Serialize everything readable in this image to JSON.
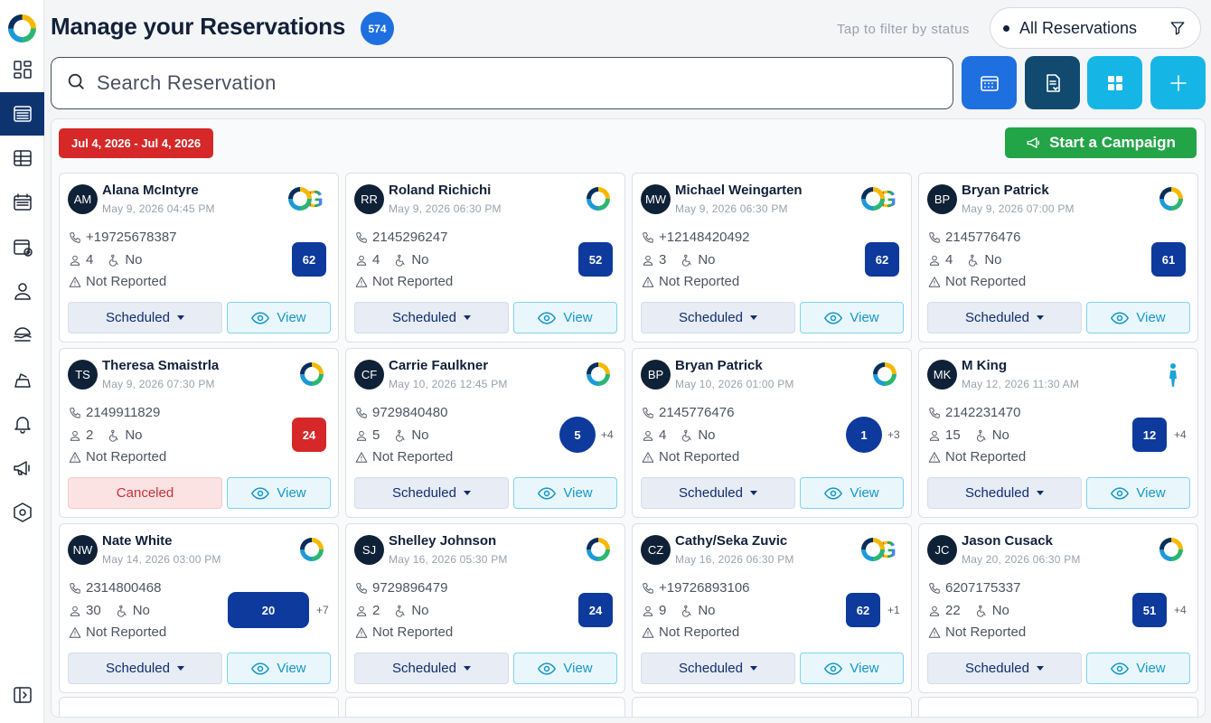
{
  "header": {
    "title": "Manage your Reservations",
    "count": "574",
    "filter_hint": "Tap to filter by status",
    "status_filter": "All Reservations"
  },
  "search": {
    "placeholder": "Search Reservation"
  },
  "date_range": "Jul 4, 2026 - Jul 4, 2026",
  "campaign_label": "Start a Campaign",
  "colors": {
    "primary": "#0e3470",
    "accent_blue": "#1e6fe0",
    "cyan": "#15b6e6",
    "red": "#d62828",
    "green": "#22a447"
  },
  "sidebar": {
    "items": [
      {
        "icon": "dashboard-icon"
      },
      {
        "icon": "reservations-list-icon",
        "active": true
      },
      {
        "icon": "table-grid-icon"
      },
      {
        "icon": "calendar-icon"
      },
      {
        "icon": "add-event-icon"
      },
      {
        "icon": "user-icon"
      },
      {
        "icon": "food-menu-icon"
      },
      {
        "icon": "service-bell-icon"
      },
      {
        "icon": "notification-bell-icon"
      },
      {
        "icon": "megaphone-icon"
      },
      {
        "icon": "settings-icon"
      },
      {
        "icon": "collapse-sidebar-icon"
      }
    ]
  },
  "labels": {
    "view": "View"
  },
  "reservations": [
    {
      "initials": "AM",
      "name": "Alana McIntyre",
      "datetime": "May 9, 2026 04:45 PM",
      "phone": "+19725678387",
      "guests": "4",
      "accessible": "No",
      "report": "Not Reported",
      "table": "62",
      "extra": "",
      "status": "Scheduled",
      "source": "og"
    },
    {
      "initials": "RR",
      "name": "Roland Richichi",
      "datetime": "May 9, 2026 06:30 PM",
      "phone": "2145296247",
      "guests": "4",
      "accessible": "No",
      "report": "Not Reported",
      "table": "52",
      "extra": "",
      "status": "Scheduled",
      "source": "ring"
    },
    {
      "initials": "MW",
      "name": "Michael Weingarten",
      "datetime": "May 9, 2026 06:30 PM",
      "phone": "+12148420492",
      "guests": "3",
      "accessible": "No",
      "report": "Not Reported",
      "table": "62",
      "extra": "",
      "status": "Scheduled",
      "source": "og"
    },
    {
      "initials": "BP",
      "name": "Bryan Patrick",
      "datetime": "May 9, 2026 07:00 PM",
      "phone": "2145776476",
      "guests": "4",
      "accessible": "No",
      "report": "Not Reported",
      "table": "61",
      "extra": "",
      "status": "Scheduled",
      "source": "ring"
    },
    {
      "initials": "TS",
      "name": "Theresa Smaistrla",
      "datetime": "May 9, 2026 07:30 PM",
      "phone": "2149911829",
      "guests": "2",
      "accessible": "No",
      "report": "Not Reported",
      "table": "24",
      "extra": "",
      "status": "Canceled",
      "source": "ring"
    },
    {
      "initials": "CF",
      "name": "Carrie Faulkner",
      "datetime": "May 10, 2026 12:45 PM",
      "phone": "9729840480",
      "guests": "5",
      "accessible": "No",
      "report": "Not Reported",
      "table": "5",
      "extra": "+4",
      "status": "Scheduled",
      "source": "ring"
    },
    {
      "initials": "BP",
      "name": "Bryan Patrick",
      "datetime": "May 10, 2026 01:00 PM",
      "phone": "2145776476",
      "guests": "4",
      "accessible": "No",
      "report": "Not Reported",
      "table": "1",
      "extra": "+3",
      "status": "Scheduled",
      "source": "ring"
    },
    {
      "initials": "MK",
      "name": "M King",
      "datetime": "May 12, 2026 11:30 AM",
      "phone": "2142231470",
      "guests": "15",
      "accessible": "No",
      "report": "Not Reported",
      "table": "12",
      "extra": "+4",
      "status": "Scheduled",
      "source": "walkin"
    },
    {
      "initials": "NW",
      "name": "Nate White",
      "datetime": "May 14, 2026 03:00 PM",
      "phone": "2314800468",
      "guests": "30",
      "accessible": "No",
      "report": "Not Reported",
      "table": "20",
      "extra": "+7",
      "status": "Scheduled",
      "source": "ring"
    },
    {
      "initials": "SJ",
      "name": "Shelley Johnson",
      "datetime": "May 16, 2026 05:30 PM",
      "phone": "9729896479",
      "guests": "2",
      "accessible": "No",
      "report": "Not Reported",
      "table": "24",
      "extra": "",
      "status": "Scheduled",
      "source": "ring"
    },
    {
      "initials": "CZ",
      "name": "Cathy/Seka Zuvic",
      "datetime": "May 16, 2026 06:30 PM",
      "phone": "+19726893106",
      "guests": "9",
      "accessible": "No",
      "report": "Not Reported",
      "table": "62",
      "extra": "+1",
      "status": "Scheduled",
      "source": "og"
    },
    {
      "initials": "JC",
      "name": "Jason Cusack",
      "datetime": "May 20, 2026 06:30 PM",
      "phone": "6207175337",
      "guests": "22",
      "accessible": "No",
      "report": "Not Reported",
      "table": "51",
      "extra": "+4",
      "status": "Scheduled",
      "source": "ring"
    }
  ]
}
